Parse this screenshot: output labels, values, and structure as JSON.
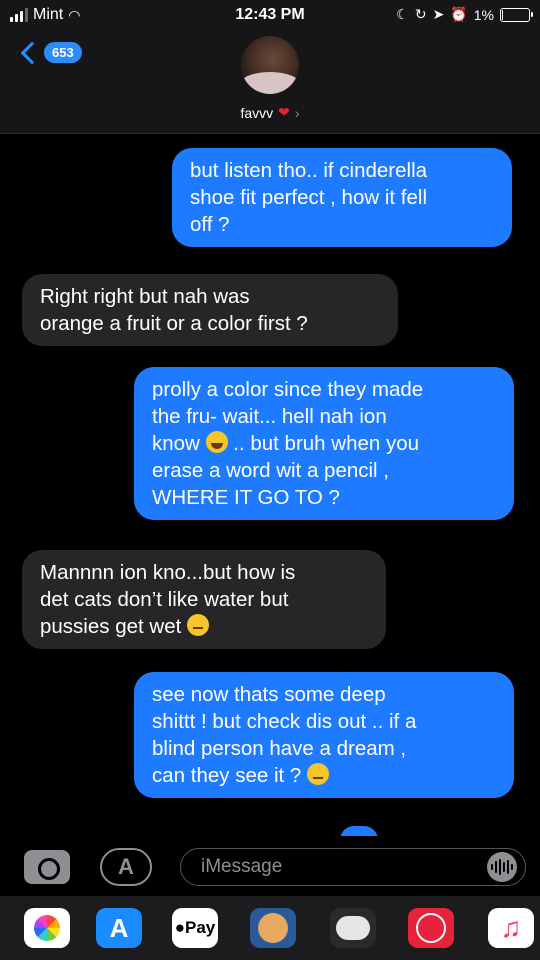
{
  "status_bar": {
    "carrier": "Mint",
    "time": "12:43 PM",
    "battery_percent": "1%",
    "battery_level": 0.01
  },
  "header": {
    "back_count": "653",
    "contact_name": "favvv"
  },
  "messages": [
    {
      "direction": "outgoing",
      "lines": [
        "but listen tho.. if cinderella",
        "shoe fit perfect , how it fell",
        "off ?"
      ]
    },
    {
      "direction": "incoming",
      "lines": [
        "Right right but nah was",
        "orange a fruit or a color first ?"
      ]
    },
    {
      "direction": "outgoing",
      "lines": [
        "prolly a color since they made",
        "the fru- wait... hell nah ion",
        "know",
        " .. but bruh when you",
        "erase a word wit a pencil ,",
        "WHERE IT GO TO ?"
      ]
    },
    {
      "direction": "incoming",
      "lines": [
        "Mannnn ion kno...but how is",
        "det cats don’t like water but",
        "pussies get wet"
      ]
    },
    {
      "direction": "outgoing",
      "lines": [
        "see now thats some deep",
        "shittt !  but check dis out .. if a",
        "blind person have a dream ,",
        "can they see it ?"
      ]
    }
  ],
  "input": {
    "placeholder": "iMessage"
  },
  "app_drawer": {
    "pay_label": "Pay",
    "icons": [
      "photos-icon",
      "app-store-icon",
      "apple-pay-icon",
      "memoji-icon",
      "game-icon",
      "web-search-icon",
      "music-icon"
    ]
  },
  "colors": {
    "outgoing_bubble": "#1e7bff",
    "incoming_bubble": "#262628",
    "accent": "#2b8cff"
  }
}
